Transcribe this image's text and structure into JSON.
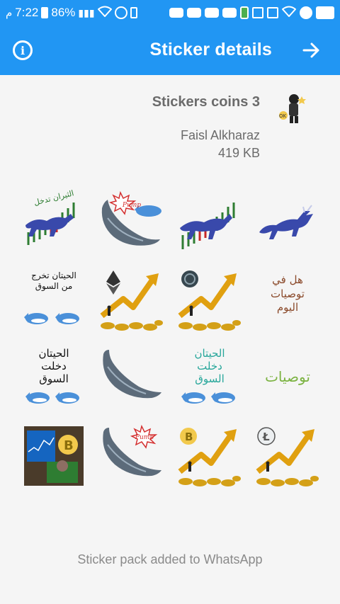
{
  "status_bar": {
    "time": "7:22",
    "left_glyph": "م",
    "battery_percent": "86%",
    "icons": [
      "battery-icon",
      "signal-icon",
      "wifi-icon",
      "data-saver-icon",
      "battery-saver-icon",
      "youtube-icon",
      "whatsapp-icon",
      "checkbox-icon",
      "gallery-icon",
      "smiley-icon",
      "message-icon"
    ]
  },
  "app_bar": {
    "title": "Sticker details",
    "info_icon": "info-icon",
    "next_icon": "arrow-right-icon"
  },
  "pack": {
    "name": "Stickers coins 3",
    "author": "Faisl Alkharaz",
    "size": "419 KB"
  },
  "stickers": [
    {
      "name": "sticker-bull-chart-top",
      "text": "الثيران تدخل"
    },
    {
      "name": "sticker-whale-pump",
      "text": "Pump"
    },
    {
      "name": "sticker-bull-chart",
      "text": ""
    },
    {
      "name": "sticker-bull",
      "text": ""
    },
    {
      "name": "sticker-whales-leave",
      "text": "الحيتان تخرج من السوق"
    },
    {
      "name": "sticker-ethereum-rise",
      "text": ""
    },
    {
      "name": "sticker-ripple-rise",
      "text": ""
    },
    {
      "name": "sticker-recommendations-today",
      "text": "هل في توصيات اليوم"
    },
    {
      "name": "sticker-whales-enter",
      "text": "الحيتان دخلت السوق"
    },
    {
      "name": "sticker-whale",
      "text": ""
    },
    {
      "name": "sticker-whales-enter-color",
      "text": "الحيتان دخلت السوق"
    },
    {
      "name": "sticker-recommendations",
      "text": "توصيات"
    },
    {
      "name": "sticker-bitcoin-trader",
      "text": ""
    },
    {
      "name": "sticker-whale-pump-2",
      "text": "Pump"
    },
    {
      "name": "sticker-bitcoin-rise",
      "text": ""
    },
    {
      "name": "sticker-litecoin-rise",
      "text": ""
    }
  ],
  "footer": {
    "status": "Sticker pack added to WhatsApp"
  },
  "colors": {
    "primary": "#2196f3",
    "background": "#f5f5f5",
    "text_secondary": "#6b6b6b",
    "footer_text": "#8a8a8a"
  }
}
